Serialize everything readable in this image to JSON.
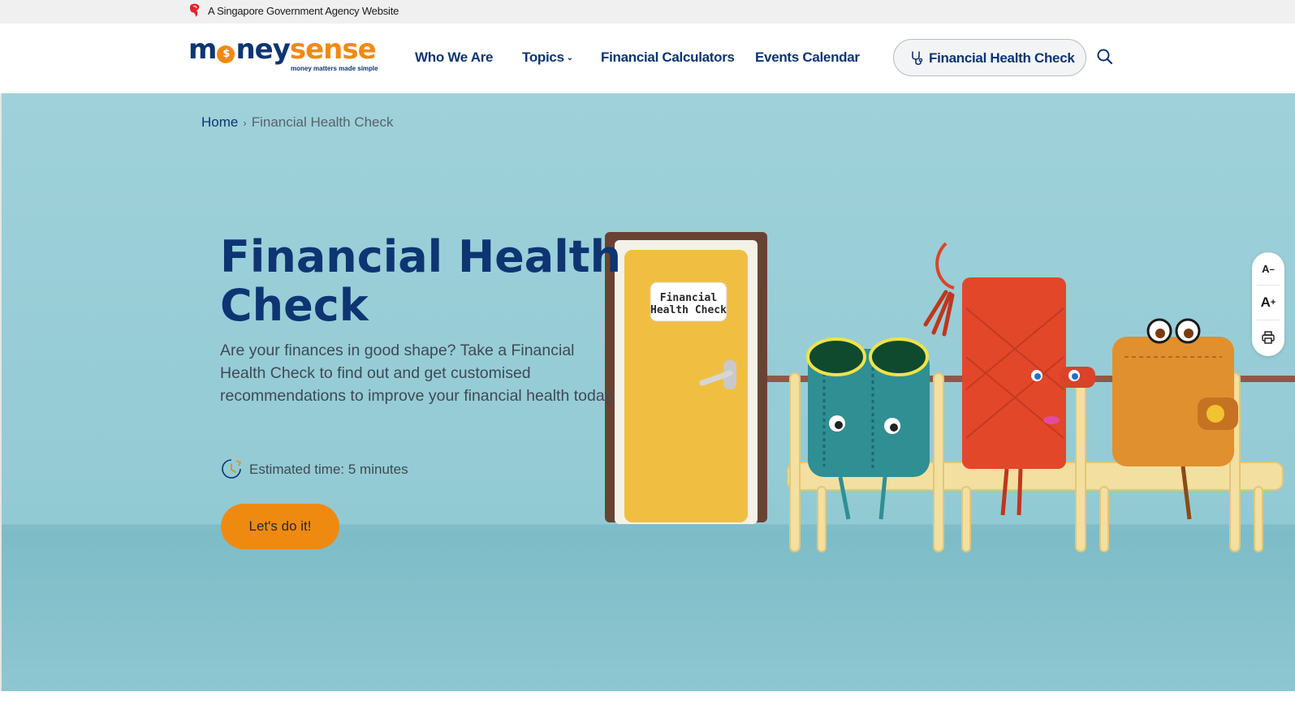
{
  "gov_bar": {
    "text": "A Singapore Government Agency Website"
  },
  "logo": {
    "word_start": "m",
    "word_coin": "$",
    "word_mid": "ney",
    "word_end": "sense",
    "tagline": "money matters made simple"
  },
  "nav": {
    "items": [
      {
        "label": "Who We Are"
      },
      {
        "label": "Topics"
      },
      {
        "label": "Financial Calculators"
      },
      {
        "label": "Events Calendar"
      }
    ],
    "cta_label": "Financial Health Check"
  },
  "breadcrumb": {
    "home": "Home",
    "separator": "›",
    "current": "Financial Health Check"
  },
  "hero": {
    "title": "Financial Health Check",
    "description": "Are your finances in good shape? Take a Financial Health Check to find out and get customised recommendations to improve your financial health today.",
    "estimated_time": "Estimated time: 5 minutes",
    "cta_label": "Let's do it!",
    "door_sign_line1": "Financial",
    "door_sign_line2": "Health Check"
  },
  "text_tools": {
    "decrease": "A",
    "decrease_sym": "−",
    "increase": "A",
    "increase_sym": "+"
  },
  "colors": {
    "brand_navy": "#0d3572",
    "brand_orange": "#ef8a10",
    "hero_bg": "#9fd1da"
  },
  "icons": [
    "lion-icon",
    "stethoscope-icon",
    "search-icon",
    "clock-icon",
    "chevron-down-icon",
    "print-icon"
  ]
}
